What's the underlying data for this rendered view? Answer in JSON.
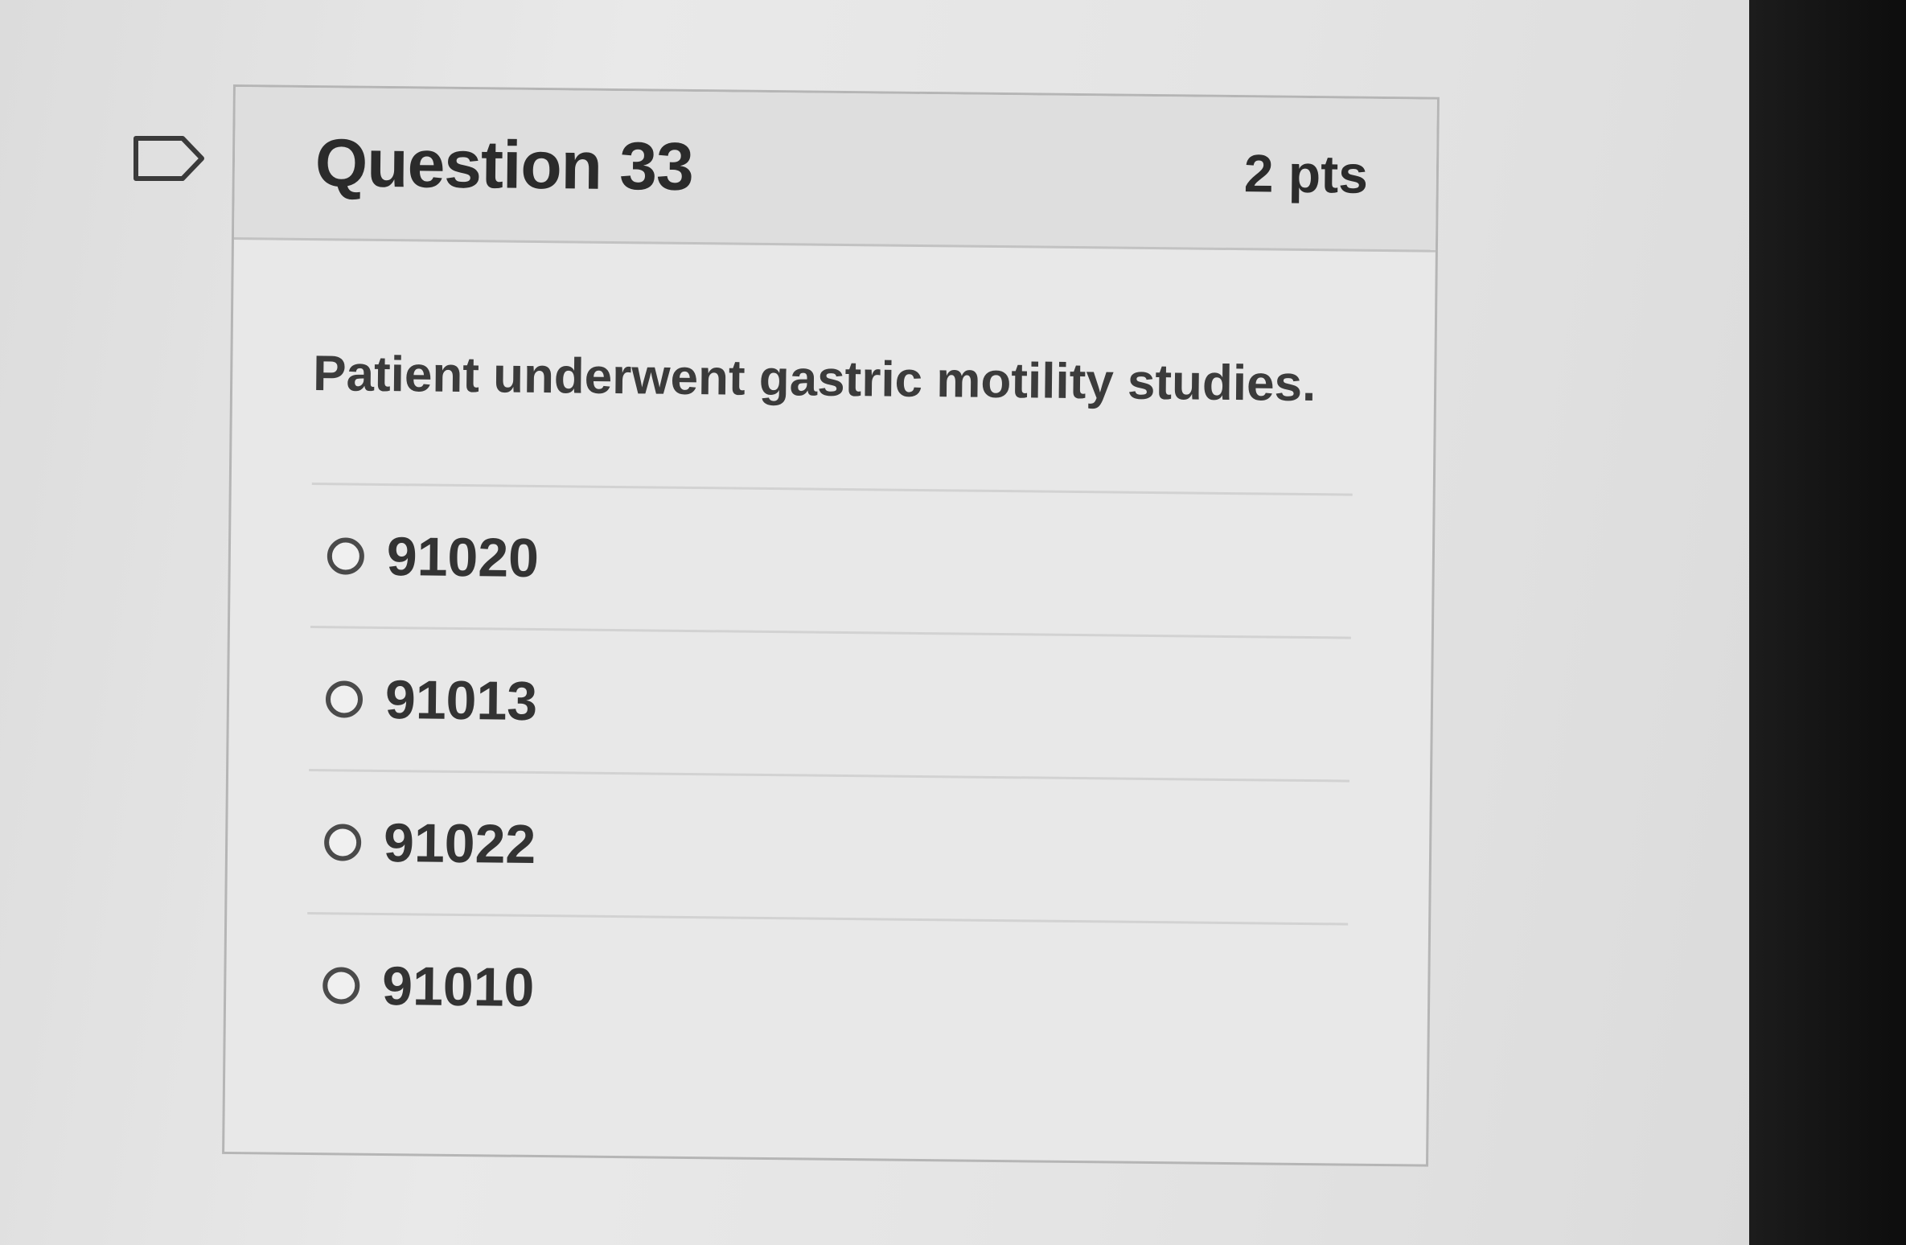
{
  "question": {
    "title": "Question 33",
    "points": "2 pts",
    "flag_icon": "flag-icon",
    "text": "Patient underwent gastric motility studies.",
    "answers": [
      {
        "label": "91020"
      },
      {
        "label": "91013"
      },
      {
        "label": "91022"
      },
      {
        "label": "91010"
      }
    ]
  }
}
